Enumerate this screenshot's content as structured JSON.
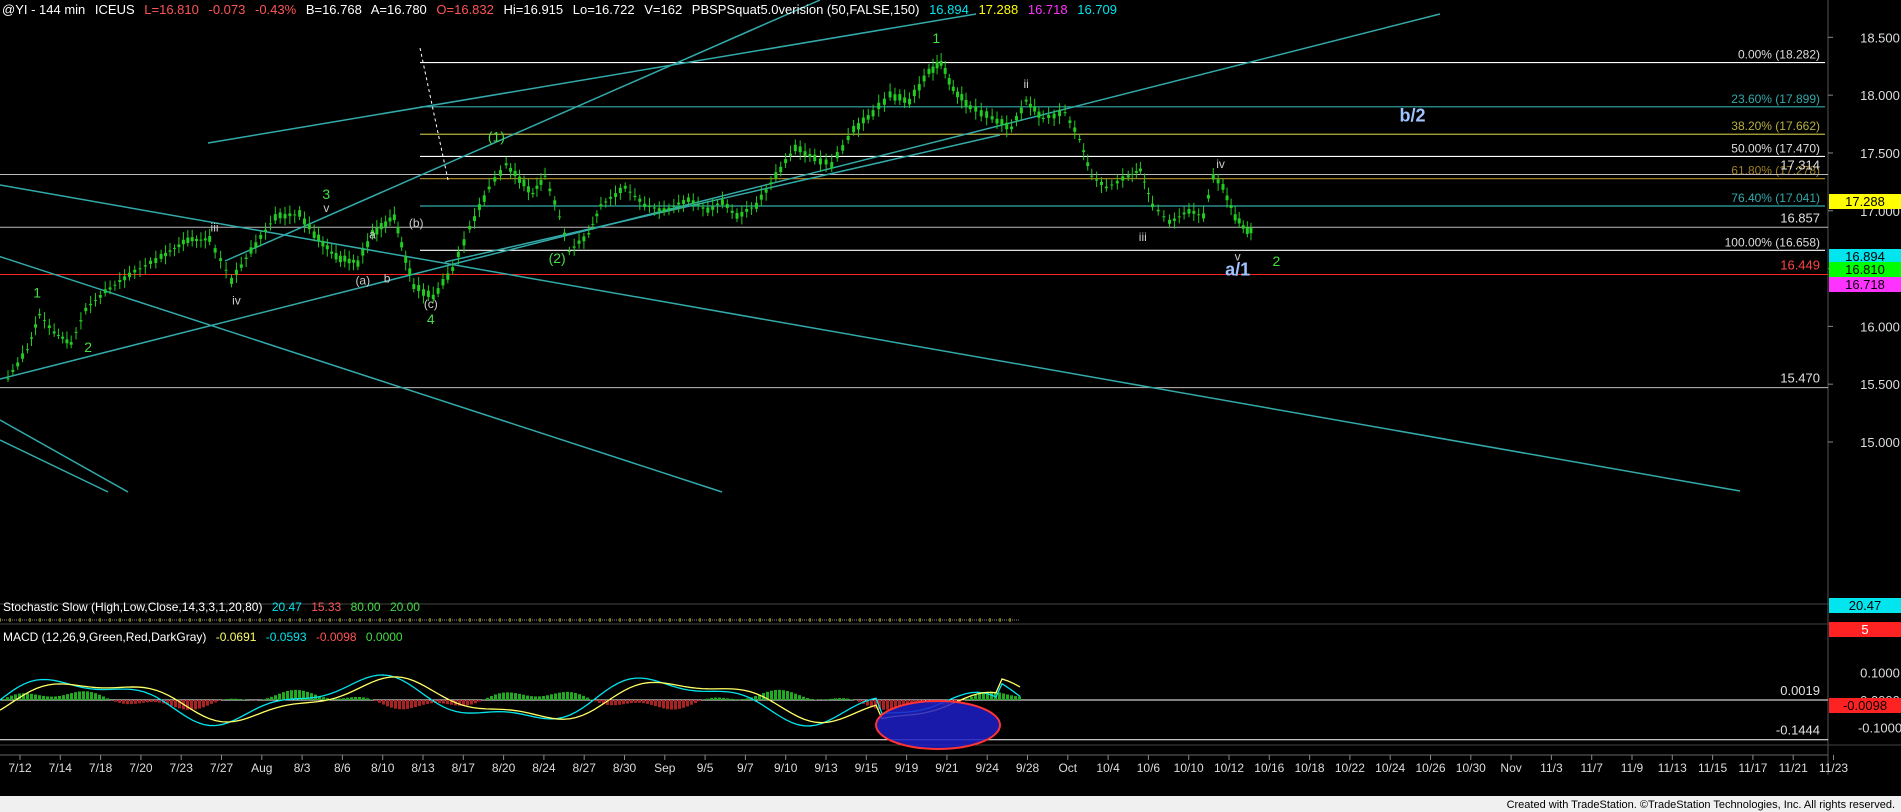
{
  "header": {
    "symbol": "@YI - 144 min",
    "exchange": "ICEUS",
    "last": "L=16.810",
    "change": "-0.073",
    "pct": "-0.43%",
    "bid": "B=16.768",
    "ask": "A=16.780",
    "open": "O=16.832",
    "high": "Hi=16.915",
    "low": "Lo=16.722",
    "volume": "V=162",
    "study": "PBSPSquat5.0verision (50,FALSE,150)",
    "study_v1": "16.894",
    "study_v2": "17.288",
    "study_v3": "16.718",
    "study_v4": "16.709"
  },
  "stochastic": {
    "title": "Stochastic Slow (High,Low,Close,14,3,3,1,20,80)",
    "v1": "20.47",
    "v2": "15.33",
    "v3": "80.00",
    "v4": "20.00",
    "axis_label_1": "20.47",
    "axis_label_2": "5"
  },
  "macd": {
    "title": "MACD (12,26,9,Green,Red,DarkGray)",
    "v1": "-0.0691",
    "v2": "-0.0593",
    "v3": "-0.0098",
    "v4": "0.0000",
    "axis_ticks": [
      "0.1000",
      "0.0000",
      "-0.1000"
    ],
    "level_labels": [
      "0.0019",
      "-0.1444"
    ],
    "tag_label": "-0.0098"
  },
  "footer": {
    "text": "Created with TradeStation. ©TradeStation Technologies, Inc. All rights reserved."
  },
  "colors": {
    "background": "#000000",
    "candle": "#22cc22",
    "trendline": "#33aaaa",
    "fib": "#ffffff",
    "support": "#ff2222",
    "wave_green": "#44dd44",
    "wave_blue": "#a0c4ff",
    "wave_gray": "#cccccc",
    "tag_yellow": "#ffff00",
    "tag_cyan": "#00e5ee",
    "tag_green": "#00ff00",
    "tag_magenta": "#ff33ff"
  },
  "chart_data": {
    "type": "candlestick",
    "yticks": [
      "18.500",
      "18.000",
      "17.500",
      "17.000",
      "16.500",
      "16.000",
      "15.500",
      "15.000"
    ],
    "ylim": [
      14.55,
      18.65
    ],
    "xticks": [
      "7/12",
      "7/14",
      "7/18",
      "7/20",
      "7/23",
      "7/27",
      "Aug",
      "8/3",
      "8/6",
      "8/10",
      "8/13",
      "8/17",
      "8/20",
      "8/24",
      "8/27",
      "8/30",
      "Sep",
      "9/5",
      "9/7",
      "9/10",
      "9/13",
      "9/15",
      "9/19",
      "9/21",
      "9/24",
      "9/28",
      "Oct",
      "10/4",
      "10/6",
      "10/10",
      "10/12",
      "10/16",
      "10/18",
      "10/22",
      "10/24",
      "10/26",
      "10/30",
      "Nov",
      "11/3",
      "11/7",
      "11/9",
      "11/13",
      "11/15",
      "11/17",
      "11/21",
      "11/23"
    ],
    "price_path": [
      {
        "x": 0,
        "y": 15.55
      },
      {
        "x": 0.8,
        "y": 15.8
      },
      {
        "x": 1.3,
        "y": 16.1
      },
      {
        "x": 1.9,
        "y": 15.95
      },
      {
        "x": 2.6,
        "y": 15.85
      },
      {
        "x": 3.2,
        "y": 16.15
      },
      {
        "x": 4.0,
        "y": 16.3
      },
      {
        "x": 5.0,
        "y": 16.45
      },
      {
        "x": 6.3,
        "y": 16.6
      },
      {
        "x": 7.4,
        "y": 16.75
      },
      {
        "x": 8.3,
        "y": 16.75
      },
      {
        "x": 9.2,
        "y": 16.4
      },
      {
        "x": 10.0,
        "y": 16.65
      },
      {
        "x": 11.0,
        "y": 16.95
      },
      {
        "x": 12.0,
        "y": 16.97
      },
      {
        "x": 12.6,
        "y": 16.8
      },
      {
        "x": 13.5,
        "y": 16.6
      },
      {
        "x": 14.4,
        "y": 16.55
      },
      {
        "x": 15.0,
        "y": 16.8
      },
      {
        "x": 15.9,
        "y": 16.95
      },
      {
        "x": 16.2,
        "y": 16.7
      },
      {
        "x": 16.7,
        "y": 16.35
      },
      {
        "x": 17.5,
        "y": 16.25
      },
      {
        "x": 18.3,
        "y": 16.5
      },
      {
        "x": 19.0,
        "y": 16.85
      },
      {
        "x": 19.8,
        "y": 17.2
      },
      {
        "x": 20.5,
        "y": 17.4
      },
      {
        "x": 21.6,
        "y": 17.15
      },
      {
        "x": 22.1,
        "y": 17.3
      },
      {
        "x": 22.7,
        "y": 16.95
      },
      {
        "x": 23.1,
        "y": 16.65
      },
      {
        "x": 23.9,
        "y": 16.8
      },
      {
        "x": 24.4,
        "y": 17.05
      },
      {
        "x": 25.4,
        "y": 17.2
      },
      {
        "x": 26.2,
        "y": 17.05
      },
      {
        "x": 27.0,
        "y": 17.0
      },
      {
        "x": 28.0,
        "y": 17.1
      },
      {
        "x": 28.8,
        "y": 17.0
      },
      {
        "x": 29.4,
        "y": 17.08
      },
      {
        "x": 30.0,
        "y": 16.95
      },
      {
        "x": 30.8,
        "y": 17.05
      },
      {
        "x": 31.6,
        "y": 17.3
      },
      {
        "x": 32.4,
        "y": 17.55
      },
      {
        "x": 33.2,
        "y": 17.45
      },
      {
        "x": 33.9,
        "y": 17.4
      },
      {
        "x": 34.8,
        "y": 17.7
      },
      {
        "x": 35.6,
        "y": 17.85
      },
      {
        "x": 36.3,
        "y": 18.0
      },
      {
        "x": 37.1,
        "y": 17.95
      },
      {
        "x": 37.9,
        "y": 18.2
      },
      {
        "x": 38.4,
        "y": 18.28
      },
      {
        "x": 38.9,
        "y": 18.05
      },
      {
        "x": 39.6,
        "y": 17.9
      },
      {
        "x": 40.5,
        "y": 17.8
      },
      {
        "x": 41.3,
        "y": 17.72
      },
      {
        "x": 41.9,
        "y": 17.95
      },
      {
        "x": 42.6,
        "y": 17.8
      },
      {
        "x": 43.5,
        "y": 17.85
      },
      {
        "x": 44.1,
        "y": 17.62
      },
      {
        "x": 44.6,
        "y": 17.3
      },
      {
        "x": 45.2,
        "y": 17.2
      },
      {
        "x": 46.1,
        "y": 17.3
      },
      {
        "x": 46.6,
        "y": 17.35
      },
      {
        "x": 47.1,
        "y": 17.05
      },
      {
        "x": 47.8,
        "y": 16.9
      },
      {
        "x": 48.6,
        "y": 17.0
      },
      {
        "x": 49.2,
        "y": 16.95
      },
      {
        "x": 49.6,
        "y": 17.3
      },
      {
        "x": 50.0,
        "y": 17.2
      },
      {
        "x": 50.5,
        "y": 16.95
      },
      {
        "x": 51.0,
        "y": 16.82
      },
      {
        "x": 51.3,
        "y": 16.85
      }
    ],
    "fib_levels": [
      {
        "label": "0.00% (18.282)",
        "value": 18.282
      },
      {
        "label": "23.60% (17.899)",
        "value": 17.899
      },
      {
        "label": "38.20% (17.662)",
        "value": 17.662
      },
      {
        "label": "50.00% (17.470)",
        "value": 17.47
      },
      {
        "label": "61.80% (17.278)",
        "value": 17.278
      },
      {
        "label": "76.40% (17.041)",
        "value": 17.041
      },
      {
        "label": "100.00% (16.658)",
        "value": 16.658
      }
    ],
    "level_labels": [
      {
        "label": "17.314",
        "value": 17.314
      },
      {
        "label": "16.857",
        "value": 16.857
      },
      {
        "label": "16.449",
        "value": 16.449
      },
      {
        "label": "15.470",
        "value": 15.47
      }
    ],
    "price_tags": [
      {
        "label": "17.288",
        "value": 17.288,
        "color": "#ffff00"
      },
      {
        "label": "16.894",
        "value": 16.894,
        "color": "#00e5ee"
      },
      {
        "label": "16.810",
        "value": 16.81,
        "color": "#00ff00"
      },
      {
        "label": "16.718",
        "value": 16.718,
        "color": "#ff33ff"
      }
    ],
    "wave_labels": [
      {
        "text": "1",
        "x": 1.2,
        "y": 16.25,
        "color": "#44dd44"
      },
      {
        "text": "2",
        "x": 3.3,
        "y": 15.78,
        "color": "#44dd44"
      },
      {
        "text": "iii",
        "x": 8.5,
        "y": 16.82,
        "color": "#cccccc"
      },
      {
        "text": "iv",
        "x": 9.4,
        "y": 16.19,
        "color": "#cccccc"
      },
      {
        "text": "3",
        "x": 13.1,
        "y": 17.1,
        "color": "#44dd44"
      },
      {
        "text": "v",
        "x": 13.1,
        "y": 16.99,
        "color": "#cccccc"
      },
      {
        "text": "(a)",
        "x": 14.6,
        "y": 16.36,
        "color": "#cccccc"
      },
      {
        "text": "b",
        "x": 15.6,
        "y": 16.38,
        "color": "#cccccc"
      },
      {
        "text": "a",
        "x": 15.0,
        "y": 16.76,
        "color": "#cccccc"
      },
      {
        "text": "(b)",
        "x": 16.8,
        "y": 16.86,
        "color": "#cccccc"
      },
      {
        "text": "(c)",
        "x": 17.4,
        "y": 16.16,
        "color": "#cccccc"
      },
      {
        "text": "4",
        "x": 17.4,
        "y": 16.02,
        "color": "#44dd44"
      },
      {
        "text": "(1)",
        "x": 20.1,
        "y": 17.6,
        "color": "#44dd44"
      },
      {
        "text": "(2)",
        "x": 22.6,
        "y": 16.55,
        "color": "#44dd44"
      },
      {
        "text": "1",
        "x": 38.2,
        "y": 18.45,
        "color": "#44dd44"
      },
      {
        "text": "ii",
        "x": 41.9,
        "y": 18.06,
        "color": "#cccccc"
      },
      {
        "text": "iii",
        "x": 46.7,
        "y": 16.74,
        "color": "#cccccc"
      },
      {
        "text": "iv",
        "x": 49.9,
        "y": 17.37,
        "color": "#cccccc"
      },
      {
        "text": "v",
        "x": 50.6,
        "y": 16.57,
        "color": "#cccccc"
      },
      {
        "text": "a/1",
        "x": 50.6,
        "y": 16.44,
        "color": "#a0c4ff"
      },
      {
        "text": "2",
        "x": 52.2,
        "y": 16.52,
        "color": "#44dd44"
      },
      {
        "text": "b/2",
        "x": 57.8,
        "y": 17.77,
        "color": "#a0c4ff"
      }
    ]
  }
}
